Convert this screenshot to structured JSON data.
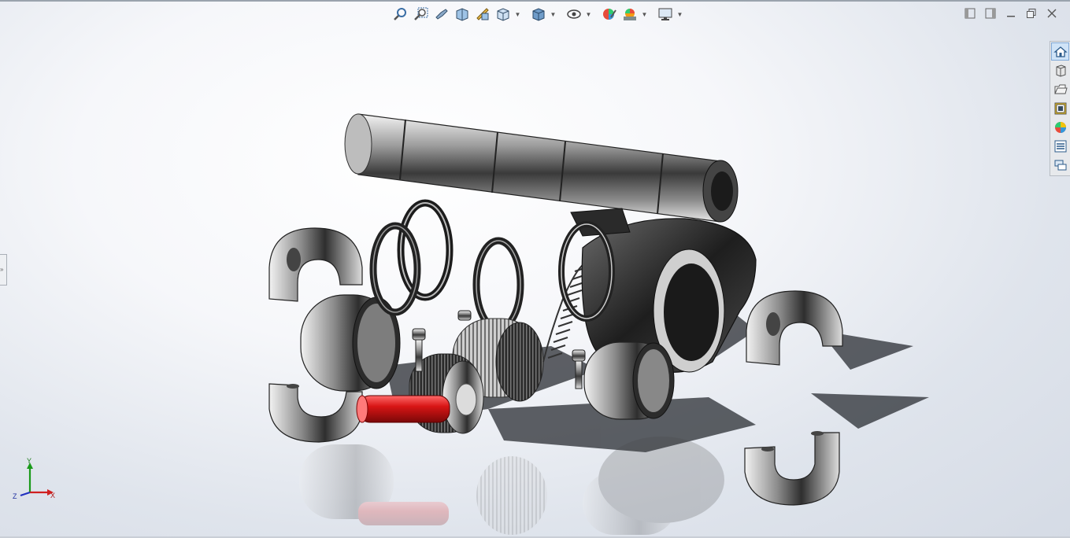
{
  "view_toolbar": {
    "items": [
      {
        "icon": "zoom-to-fit-icon"
      },
      {
        "icon": "zoom-to-area-icon"
      },
      {
        "icon": "previous-view-icon"
      },
      {
        "icon": "section-view-icon"
      },
      {
        "icon": "dynamic-annotation-views-icon"
      },
      {
        "icon": "view-orientation-icon"
      },
      {
        "icon": "display-style-icon"
      },
      {
        "icon": "hide-show-items-icon"
      },
      {
        "icon": "edit-appearance-icon"
      },
      {
        "icon": "apply-scene-icon"
      },
      {
        "icon": "view-settings-icon"
      }
    ]
  },
  "window_controls": [
    "tile-left-icon",
    "tile-right-icon",
    "minimize-icon",
    "restore-icon",
    "close-icon"
  ],
  "task_pane": {
    "tabs": [
      {
        "icon": "solidworks-resources-icon",
        "active": true
      },
      {
        "icon": "design-library-icon"
      },
      {
        "icon": "file-explorer-icon"
      },
      {
        "icon": "view-palette-icon"
      },
      {
        "icon": "appearances-scenes-icon"
      },
      {
        "icon": "custom-properties-icon"
      },
      {
        "icon": "forum-icon"
      }
    ]
  },
  "triad": {
    "x_label": "X",
    "y_label": "Y",
    "z_label": "Z"
  },
  "colors": {
    "accent_red": "#c81818",
    "steel": "#8a8a8a",
    "x_axis": "#d02020",
    "y_axis": "#1a9a1a",
    "z_axis": "#2030c0"
  }
}
